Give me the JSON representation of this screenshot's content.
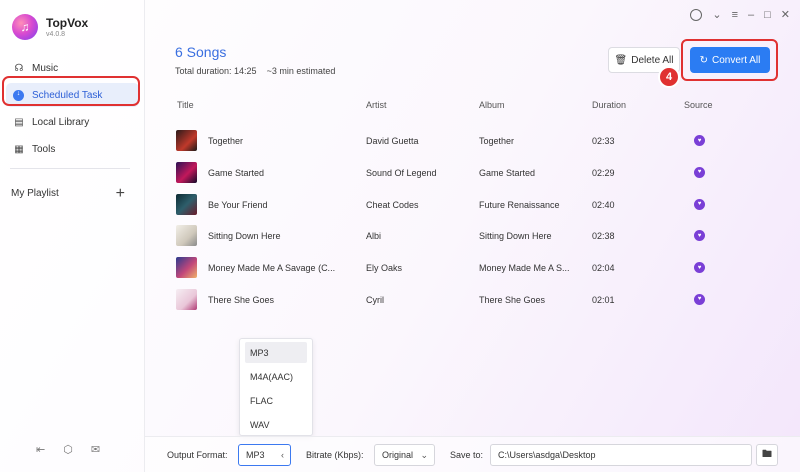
{
  "app": {
    "name": "TopVox",
    "version": "v4.0.8"
  },
  "sidebar": {
    "items": [
      {
        "label": "Music",
        "icon": "headphones-icon"
      },
      {
        "label": "Scheduled Task",
        "icon": "download-icon"
      },
      {
        "label": "Local Library",
        "icon": "local-library-icon"
      },
      {
        "label": "Tools",
        "icon": "tools-grid-icon"
      }
    ],
    "playlist_label": "My Playlist",
    "add_symbol": "+"
  },
  "header": {
    "title": "6 Songs",
    "duration": "Total duration: 14:25",
    "estimate": "~3 min estimated",
    "delete_label": "Delete All",
    "convert_label": "Convert All",
    "step_badge": "4"
  },
  "table": {
    "columns": [
      "Title",
      "Artist",
      "Album",
      "Duration",
      "Source"
    ],
    "rows": [
      {
        "title": "Together",
        "artist": "David Guetta",
        "album": "Together",
        "duration": "02:33"
      },
      {
        "title": "Game Started",
        "artist": "Sound Of Legend",
        "album": "Game Started",
        "duration": "02:29"
      },
      {
        "title": "Be Your Friend",
        "artist": "Cheat Codes",
        "album": "Future Renaissance",
        "duration": "02:40"
      },
      {
        "title": "Sitting Down Here",
        "artist": "Albi",
        "album": "Sitting Down Here",
        "duration": "02:38"
      },
      {
        "title": "Money Made Me A Savage (C...",
        "artist": "Ely Oaks",
        "album": "Money Made Me A S...",
        "duration": "02:04"
      },
      {
        "title": "There She Goes",
        "artist": "Cyril",
        "album": "There She Goes",
        "duration": "02:01"
      }
    ]
  },
  "format_dropdown": {
    "options": [
      "MP3",
      "M4A(AAC)",
      "FLAC",
      "WAV"
    ],
    "selected": "MP3"
  },
  "bottom": {
    "output_format_label": "Output Format:",
    "output_format_value": "MP3",
    "bitrate_label": "Bitrate (Kbps):",
    "bitrate_value": "Original",
    "save_to_label": "Save to:",
    "save_path": "C:\\Users\\asdga\\Desktop"
  },
  "colors": {
    "accent": "#2b7cf3",
    "highlight": "#e03131",
    "source_badge": "#7a3fd6"
  }
}
